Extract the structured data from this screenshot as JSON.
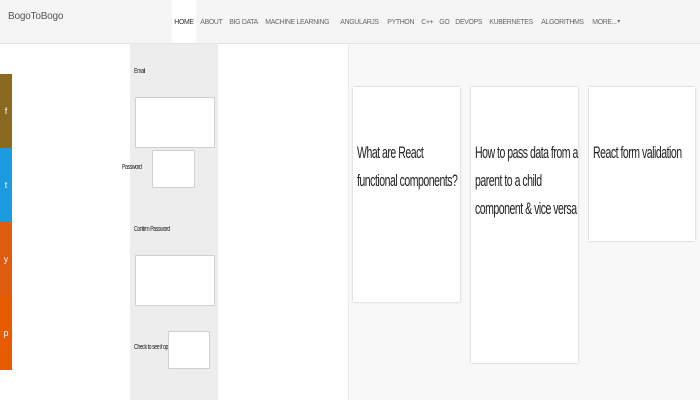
{
  "brand": "BogoToBogo",
  "nav": {
    "items": [
      "HOME",
      "ABOUT",
      "BIG DATA",
      "MACHINE LEARNING",
      "ANGULARJS",
      "PYTHON",
      "C++",
      "GO",
      "DEVOPS",
      "KUBERNETES",
      "ALGORITHMS",
      "MORE..."
    ],
    "active": "HOME"
  },
  "social": [
    {
      "icon": "facebook-icon",
      "glyph": "f",
      "color": "#8b6a1f"
    },
    {
      "icon": "twitter-icon",
      "glyph": "t",
      "color": "#1d9be0"
    },
    {
      "icon": "stumbleupon-icon",
      "glyph": "y",
      "color": "#e05a0f"
    },
    {
      "icon": "pinterest-icon",
      "glyph": "p",
      "color": "#e85b00"
    }
  ],
  "form": {
    "email_label": "Email",
    "password_label": "Password",
    "confirm_label": "Confirm Password",
    "optional_label": "Check to see if optional"
  },
  "cards": [
    {
      "title": "What are React functional components?"
    },
    {
      "title": "How to pass data from a parent to a child component & vice versa"
    },
    {
      "title": "React form validation"
    }
  ]
}
